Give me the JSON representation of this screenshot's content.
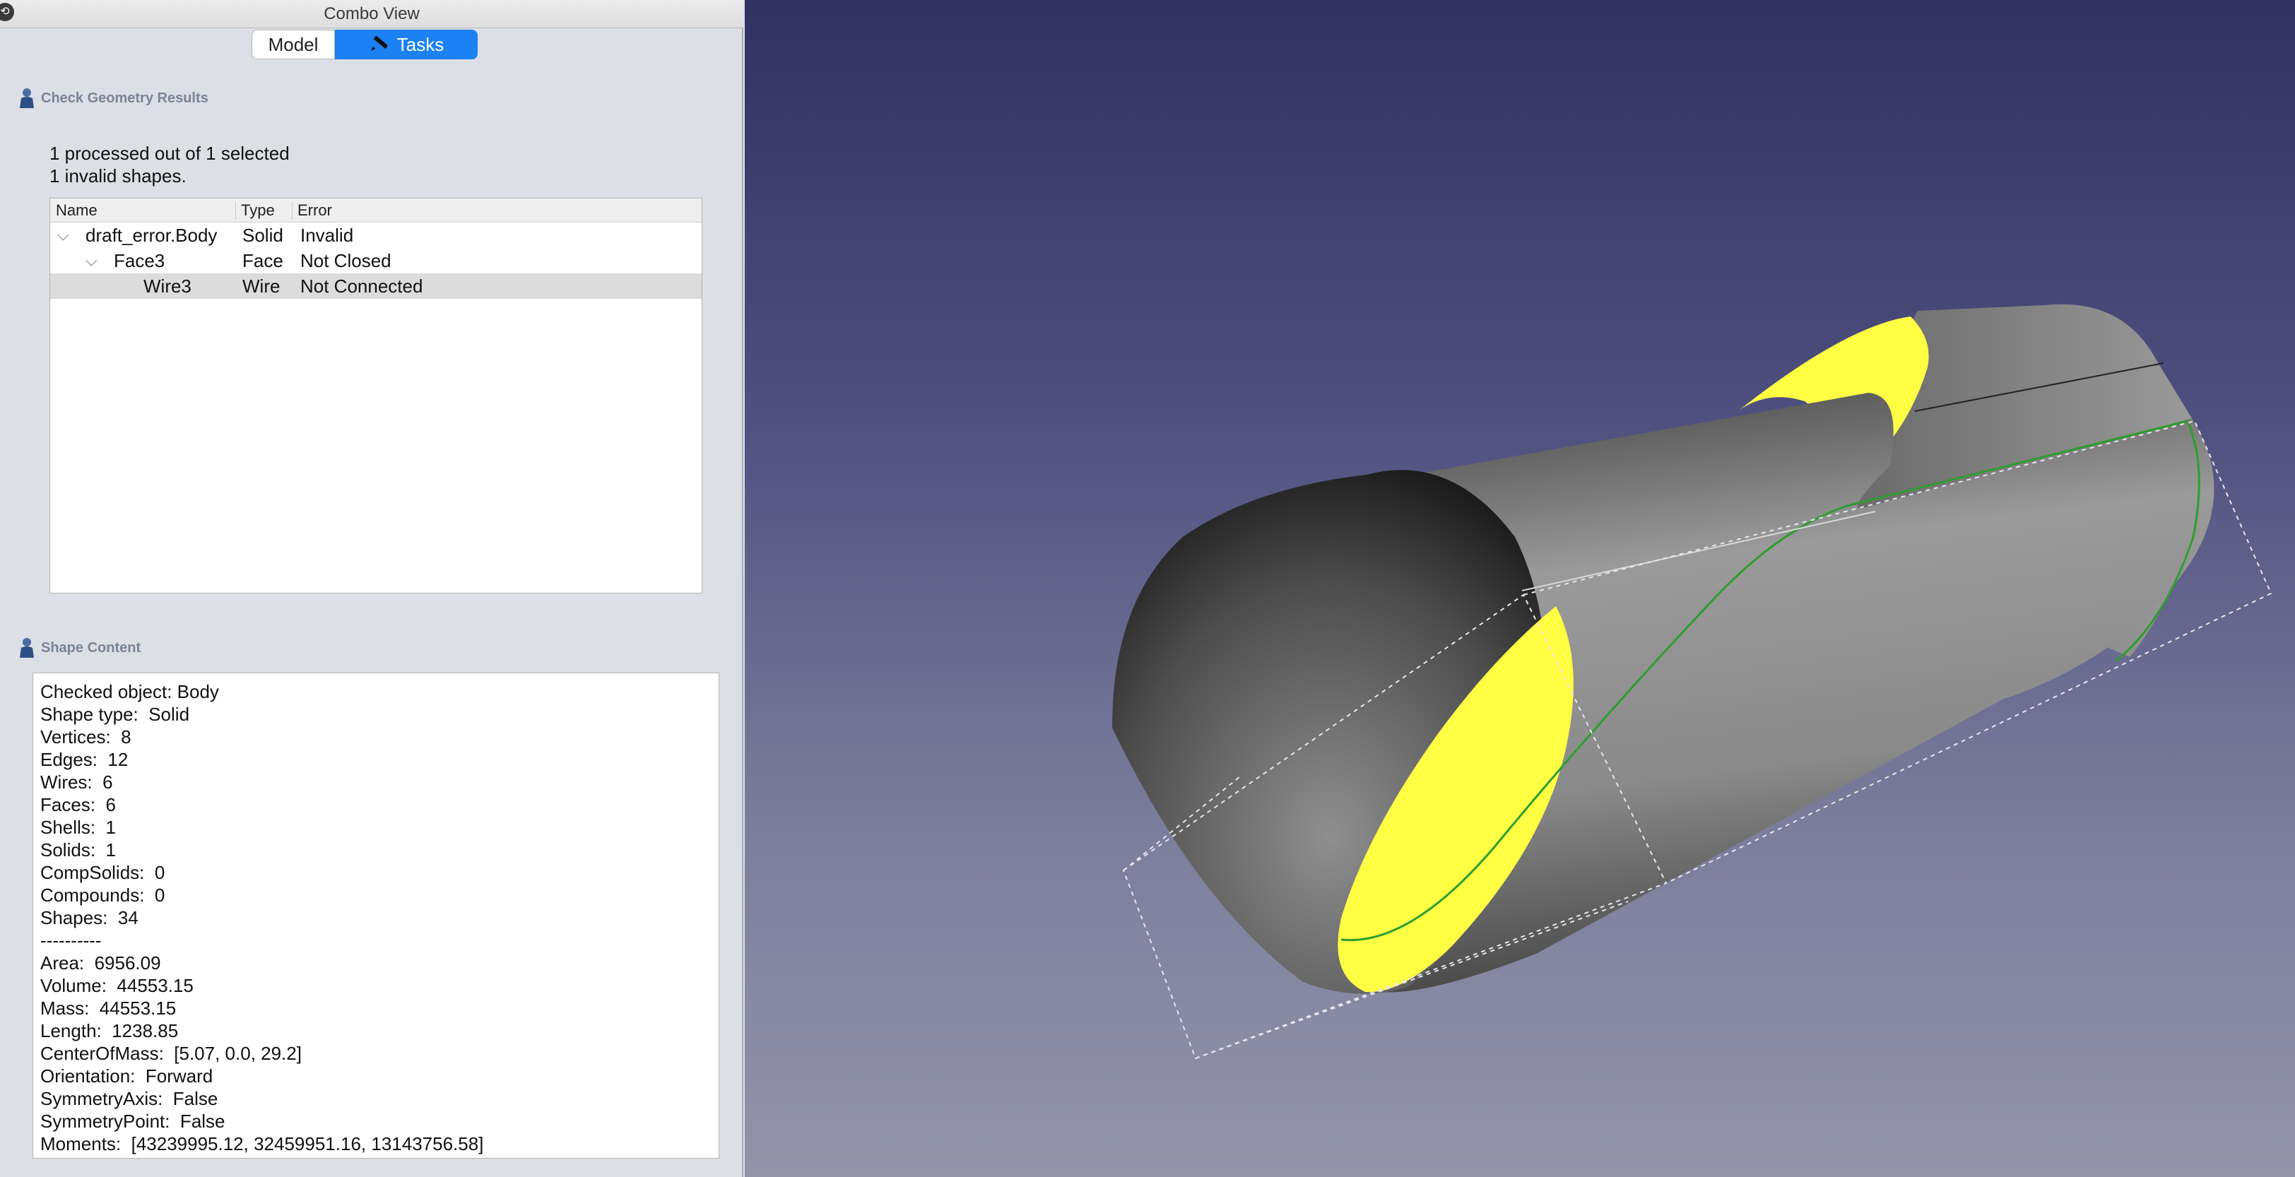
{
  "window": {
    "title": "Combo View"
  },
  "tabs": {
    "model": "Model",
    "tasks": "Tasks"
  },
  "check_results": {
    "header": "Check Geometry Results",
    "processed": "1 processed out of 1 selected",
    "invalid": "1 invalid shapes.",
    "columns": {
      "name": "Name",
      "type": "Type",
      "error": "Error"
    },
    "rows": [
      {
        "name": "draft_error.Body",
        "type": "Solid",
        "error": "Invalid"
      },
      {
        "name": "Face3",
        "type": "Face",
        "error": "Not Closed"
      },
      {
        "name": "Wire3",
        "type": "Wire",
        "error": "Not Connected"
      }
    ]
  },
  "shape_content": {
    "header": "Shape Content",
    "lines": [
      "Checked object: Body",
      "Shape type:  Solid",
      "Vertices:  8",
      "Edges:  12",
      "Wires:  6",
      "Faces:  6",
      "Shells:  1",
      "Solids:  1",
      "CompSolids:  0",
      "Compounds:  0",
      "Shapes:  34",
      "----------",
      "Area:  6956.09",
      "Volume:  44553.15",
      "Mass:  44553.15",
      "Length:  1238.85",
      "CenterOfMass:  [5.07, 0.0, 29.2]",
      "Orientation:  Forward",
      "SymmetryAxis:  False",
      "SymmetryPoint:  False",
      "Moments:  [43239995.12, 32459951.16, 13143756.58]"
    ]
  },
  "colors": {
    "tab_active": "#1c82f3",
    "face_highlight": "#ffff44",
    "edge_highlight": "#2e9e2e",
    "viewport_top": "#303062",
    "viewport_bottom": "#9394a8"
  },
  "icons": {
    "undock": "undock-icon",
    "tasks_tab": "pencil-ruler-icon",
    "section": "person-icon"
  }
}
